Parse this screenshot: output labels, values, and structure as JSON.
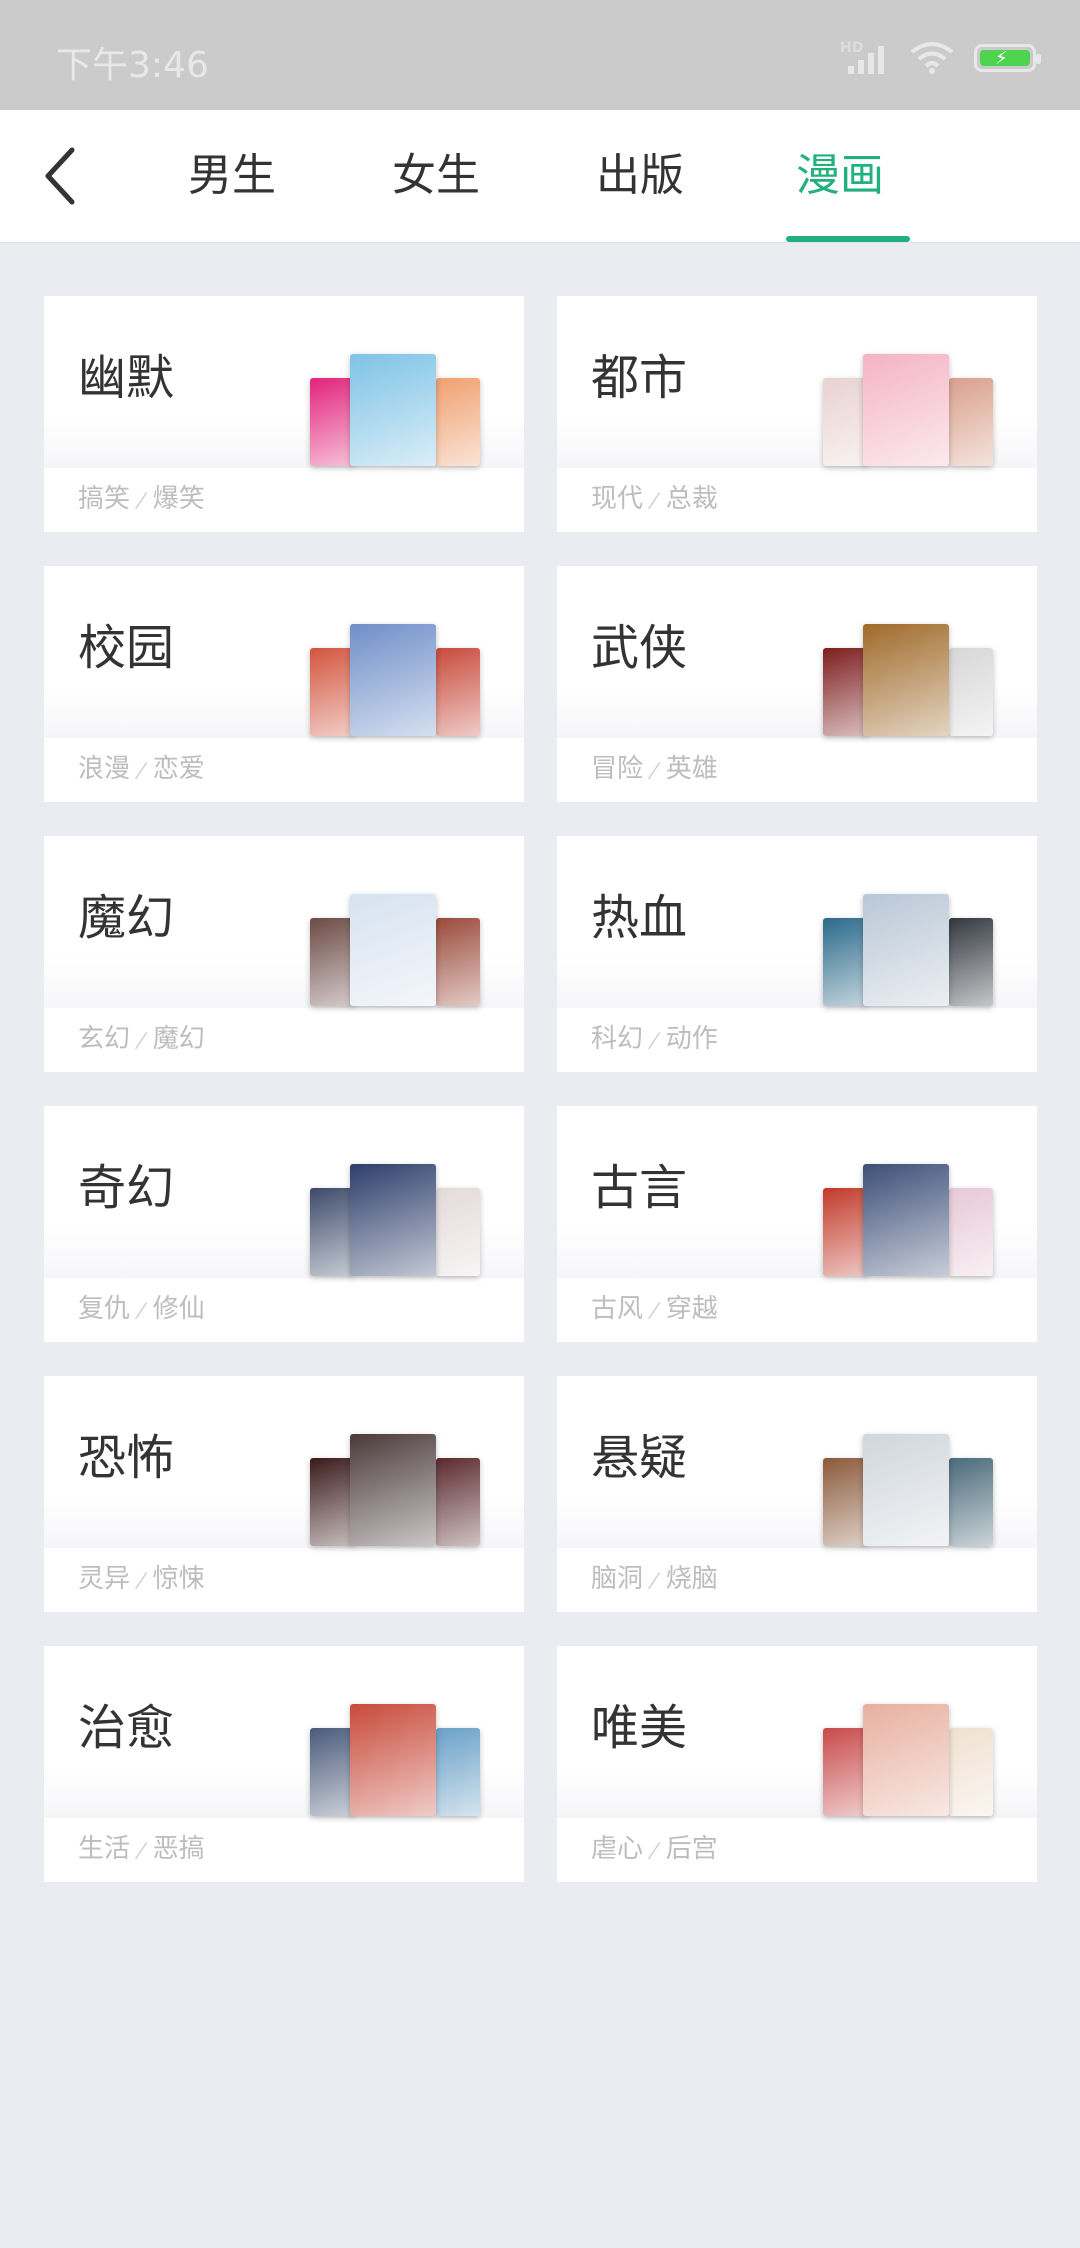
{
  "status_bar": {
    "time": "下午3:46",
    "hd_label": "HD",
    "icons": [
      "signal-icon",
      "wifi-icon",
      "battery-charging-icon"
    ]
  },
  "nav": {
    "back_icon": "chevron-left-icon",
    "tabs": [
      {
        "label": "男生",
        "active": false
      },
      {
        "label": "女生",
        "active": false
      },
      {
        "label": "出版",
        "active": false
      },
      {
        "label": "漫画",
        "active": true
      }
    ],
    "accent_color": "#22b07d"
  },
  "categories": [
    {
      "title": "幽默",
      "tags": [
        "搞笑",
        "爆笑"
      ],
      "cover_colors": [
        "#e2237b",
        "#7ec3e6",
        "#f0a070"
      ]
    },
    {
      "title": "都市",
      "tags": [
        "现代",
        "总裁"
      ],
      "cover_colors": [
        "#e8d2cf",
        "#f4b3c6",
        "#d9a08c"
      ]
    },
    {
      "title": "校园",
      "tags": [
        "浪漫",
        "恋爱"
      ],
      "cover_colors": [
        "#d2553e",
        "#6f8fc9",
        "#c84a3c"
      ]
    },
    {
      "title": "武侠",
      "tags": [
        "冒险",
        "英雄"
      ],
      "cover_colors": [
        "#7c1d1d",
        "#a06a2a",
        "#d7d7d7"
      ]
    },
    {
      "title": "魔幻",
      "tags": [
        "玄幻",
        "魔幻"
      ],
      "cover_colors": [
        "#6b4a45",
        "#d6e2f0",
        "#9a4a3a"
      ]
    },
    {
      "title": "热血",
      "tags": [
        "科幻",
        "动作"
      ],
      "cover_colors": [
        "#2a6a8a",
        "#b9c7d6",
        "#333840"
      ]
    },
    {
      "title": "奇幻",
      "tags": [
        "复仇",
        "修仙"
      ],
      "cover_colors": [
        "#3d4a6a",
        "#2d3e6b",
        "#e4dada"
      ]
    },
    {
      "title": "古言",
      "tags": [
        "古风",
        "穿越"
      ],
      "cover_colors": [
        "#c23a2a",
        "#3d4f78",
        "#e7c9d6"
      ]
    },
    {
      "title": "恐怖",
      "tags": [
        "灵异",
        "惊悚"
      ],
      "cover_colors": [
        "#3a1a1a",
        "#4a3a3a",
        "#5a2a2e"
      ]
    },
    {
      "title": "悬疑",
      "tags": [
        "脑洞",
        "烧脑"
      ],
      "cover_colors": [
        "#8a5a3a",
        "#d0d6dc",
        "#4a6a7a"
      ]
    },
    {
      "title": "治愈",
      "tags": [
        "生活",
        "恶搞"
      ],
      "cover_colors": [
        "#4a5a7a",
        "#c84a3a",
        "#6aa0c8"
      ]
    },
    {
      "title": "唯美",
      "tags": [
        "虐心",
        "后宫"
      ],
      "cover_colors": [
        "#c84a4a",
        "#e8b0a0",
        "#f0e0d0"
      ]
    }
  ]
}
